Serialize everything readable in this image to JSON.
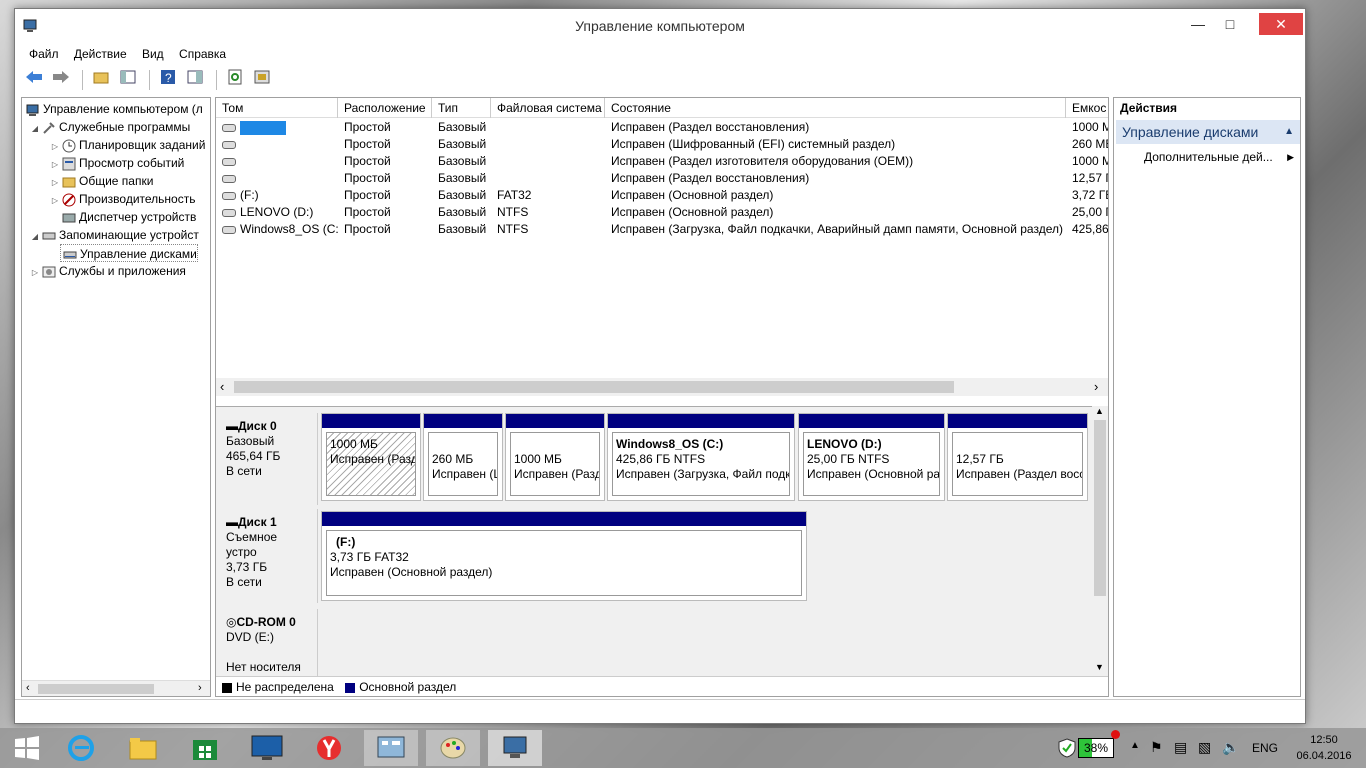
{
  "window": {
    "title": "Управление компьютером"
  },
  "menu": [
    "Файл",
    "Действие",
    "Вид",
    "Справка"
  ],
  "tree": {
    "root": "Управление компьютером (л",
    "items": [
      {
        "label": "Служебные программы",
        "level": 1
      },
      {
        "label": "Планировщик заданий",
        "level": 2
      },
      {
        "label": "Просмотр событий",
        "level": 2
      },
      {
        "label": "Общие папки",
        "level": 2
      },
      {
        "label": "Производительность",
        "level": 2
      },
      {
        "label": "Диспетчер устройств",
        "level": 2
      },
      {
        "label": "Запоминающие устройст",
        "level": 1
      },
      {
        "label": "Управление дисками",
        "level": 2
      },
      {
        "label": "Службы и приложения",
        "level": 1
      }
    ]
  },
  "columns": [
    "Том",
    "Расположение",
    "Тип",
    "Файловая система",
    "Состояние",
    "Емкос"
  ],
  "volumes": [
    {
      "name": "",
      "layout": "Простой",
      "type": "Базовый",
      "fs": "",
      "status": "Исправен (Раздел восстановления)",
      "cap": "1000 М"
    },
    {
      "name": "",
      "layout": "Простой",
      "type": "Базовый",
      "fs": "",
      "status": "Исправен (Шифрованный (EFI) системный раздел)",
      "cap": "260 МБ"
    },
    {
      "name": "",
      "layout": "Простой",
      "type": "Базовый",
      "fs": "",
      "status": "Исправен (Раздел изготовителя оборудования (OEM))",
      "cap": "1000 М"
    },
    {
      "name": "",
      "layout": "Простой",
      "type": "Базовый",
      "fs": "",
      "status": "Исправен (Раздел восстановления)",
      "cap": "12,57 Г"
    },
    {
      "name": "(F:)",
      "layout": "Простой",
      "type": "Базовый",
      "fs": "FAT32",
      "status": "Исправен (Основной раздел)",
      "cap": "3,72 ГБ"
    },
    {
      "name": "LENOVO (D:)",
      "layout": "Простой",
      "type": "Базовый",
      "fs": "NTFS",
      "status": "Исправен (Основной раздел)",
      "cap": "25,00 Г"
    },
    {
      "name": "Windows8_OS (C:)",
      "layout": "Простой",
      "type": "Базовый",
      "fs": "NTFS",
      "status": "Исправен (Загрузка, Файл подкачки, Аварийный дамп памяти, Основной раздел)",
      "cap": "425,86"
    }
  ],
  "disks": {
    "disk0": {
      "name": "Диск 0",
      "kind": "Базовый",
      "size": "465,64 ГБ",
      "state": "В сети",
      "parts": [
        {
          "title": "",
          "l1": "1000 МБ",
          "l2": "Исправен (Разд"
        },
        {
          "title": "",
          "l1": "260 МБ",
          "l2": "Исправен (L"
        },
        {
          "title": "",
          "l1": "1000 МБ",
          "l2": "Исправен (Разд"
        },
        {
          "title": "Windows8_OS  (C:)",
          "l1": "425,86 ГБ NTFS",
          "l2": "Исправен (Загрузка, Файл подка"
        },
        {
          "title": "LENOVO  (D:)",
          "l1": "25,00 ГБ NTFS",
          "l2": "Исправен (Основной ра"
        },
        {
          "title": "",
          "l1": "12,57 ГБ",
          "l2": "Исправен (Раздел восс"
        }
      ]
    },
    "disk1": {
      "name": "Диск 1",
      "kind": "Съемное устро",
      "size": "3,73 ГБ",
      "state": "В сети",
      "part": {
        "title": "(F:)",
        "l1": "3,73 ГБ FAT32",
        "l2": "Исправен (Основной раздел)"
      }
    },
    "cdrom": {
      "name": "CD-ROM 0",
      "kind": "DVD (E:)",
      "state": "Нет носителя"
    }
  },
  "legend": {
    "unallocated": "Не распределена",
    "primary": "Основной раздел"
  },
  "actions": {
    "title": "Действия",
    "group": "Управление дисками",
    "more": "Дополнительные дей..."
  },
  "taskbar": {
    "battery": "38%",
    "lang": "ENG",
    "time": "12:50",
    "date": "06.04.2016"
  },
  "colors": {
    "partition_header": "#000080",
    "close": "#e04343",
    "actions_group": "#dce6f4"
  }
}
